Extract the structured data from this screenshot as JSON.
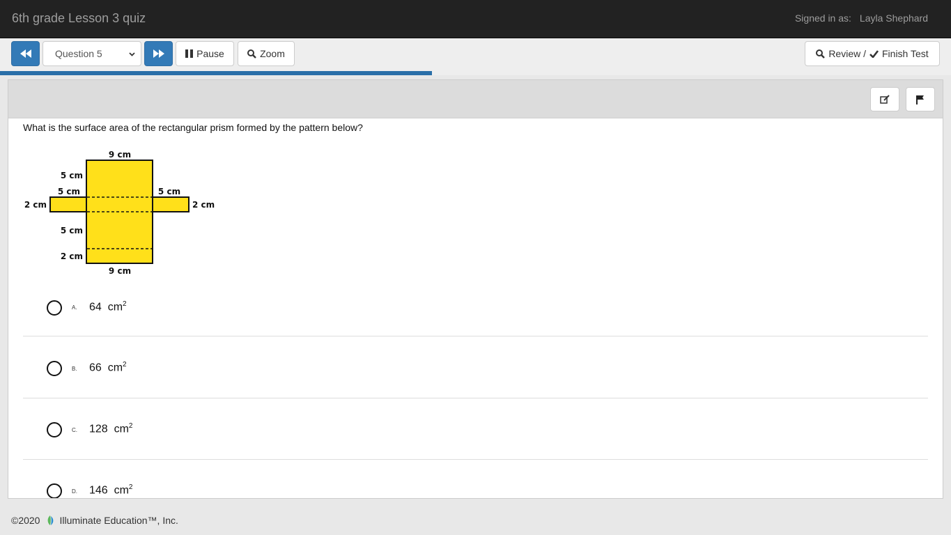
{
  "header": {
    "title": "6th grade Lesson 3 quiz",
    "signed_in_label": "Signed in as:",
    "user_name": "Layla Shephard"
  },
  "toolbar": {
    "prev_icon": "fast-backward-icon",
    "question_select": "Question 5",
    "next_icon": "fast-forward-icon",
    "pause_label": "Pause",
    "zoom_label": "Zoom",
    "review_label": "Review /",
    "finish_label": "Finish Test"
  },
  "progress": {
    "fraction": 0.454
  },
  "question": {
    "prompt": "What is the surface area of the rectangular prism formed by the pattern below?",
    "tools": {
      "notes_icon": "edit-icon",
      "flag_icon": "flag-icon"
    },
    "figure_labels": {
      "top": "9 cm",
      "bottom": "9 cm",
      "left_top": "5 cm",
      "left_flap_top": "5 cm",
      "right_flap_top": "5 cm",
      "left_side": "2 cm",
      "right_side": "2 cm",
      "left_middle": "5 cm",
      "left_bottom": "2 cm"
    },
    "choices": [
      {
        "letter": "A.",
        "value": "64",
        "unit": "cm",
        "exp": "2"
      },
      {
        "letter": "B.",
        "value": "66",
        "unit": "cm",
        "exp": "2"
      },
      {
        "letter": "C.",
        "value": "128",
        "unit": "cm",
        "exp": "2"
      },
      {
        "letter": "D.",
        "value": "146",
        "unit": "cm",
        "exp": "2"
      }
    ]
  },
  "footer": {
    "copyright": "©2020",
    "company": "Illuminate Education™, Inc.",
    "logo_icon": "illuminate-leaf-icon"
  },
  "colors": {
    "primary": "#337ab7",
    "topbar": "#222222",
    "net_fill": "#ffe01a",
    "progress": "#2a6fa8"
  }
}
